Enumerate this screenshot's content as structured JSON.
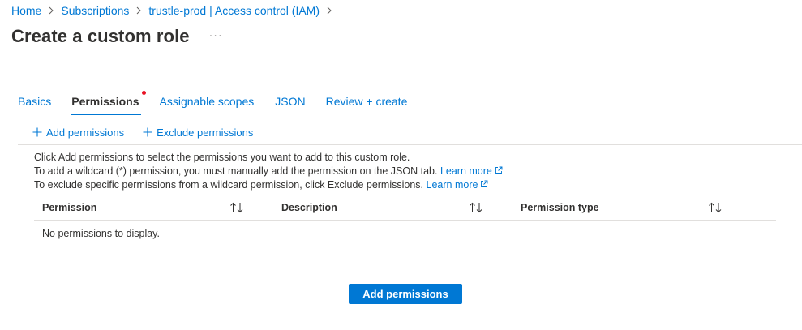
{
  "breadcrumb": [
    {
      "label": "Home"
    },
    {
      "label": "Subscriptions"
    },
    {
      "label": "trustle-prod | Access control (IAM)"
    }
  ],
  "page": {
    "title": "Create a custom role",
    "more_label": "···"
  },
  "tabs": [
    {
      "label": "Basics",
      "active": false
    },
    {
      "label": "Permissions",
      "active": true,
      "has_indicator": true
    },
    {
      "label": "Assignable scopes",
      "active": false
    },
    {
      "label": "JSON",
      "active": false
    },
    {
      "label": "Review + create",
      "active": false
    }
  ],
  "toolbar": {
    "add_label": "Add permissions",
    "exclude_label": "Exclude permissions"
  },
  "info": {
    "line1": "Click Add permissions to select the permissions you want to add to this custom role.",
    "line2": "To add a wildcard (*) permission, you must manually add the permission on the JSON tab.",
    "line3": "To exclude specific permissions from a wildcard permission, click Exclude permissions.",
    "learn_more": "Learn more"
  },
  "table": {
    "columns": [
      "Permission",
      "Description",
      "Permission type"
    ],
    "empty_message": "No permissions to display."
  },
  "primary_button": {
    "label": "Add permissions"
  },
  "colors": {
    "accent": "#0078d4",
    "indicator": "#e81123",
    "text": "#323130",
    "border": "#e1dfdd"
  }
}
